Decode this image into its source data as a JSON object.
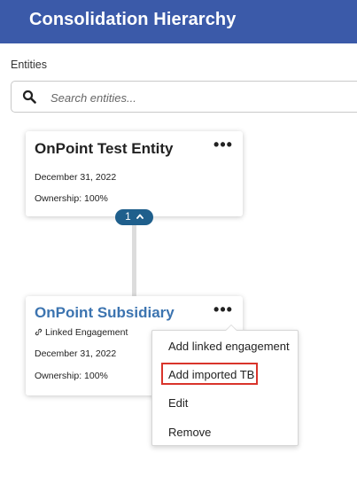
{
  "header": {
    "title": "Consolidation Hierarchy"
  },
  "entities": {
    "label": "Entities",
    "search_placeholder": "Search entities..."
  },
  "parent_card": {
    "name": "OnPoint Test Entity",
    "date": "December 31, 2022",
    "ownership": "Ownership: 100%",
    "menu": "•••",
    "children_count": "1"
  },
  "child_card": {
    "name": "OnPoint Subsidiary",
    "linked": "Linked Engagement",
    "date": "December 31, 2022",
    "ownership": "Ownership: 100%",
    "menu": "•••"
  },
  "context_menu": {
    "items": [
      "Add linked engagement",
      "Add imported TB",
      "Edit",
      "Remove"
    ],
    "highlighted_index": 1
  },
  "colors": {
    "header_bg": "#3b5aa9",
    "link_title": "#3c74b0",
    "pill_bg": "#1f5f8c",
    "highlight": "#d9342b"
  },
  "icons": [
    "search-icon",
    "link-icon",
    "chevron-up-icon",
    "more-icon"
  ]
}
